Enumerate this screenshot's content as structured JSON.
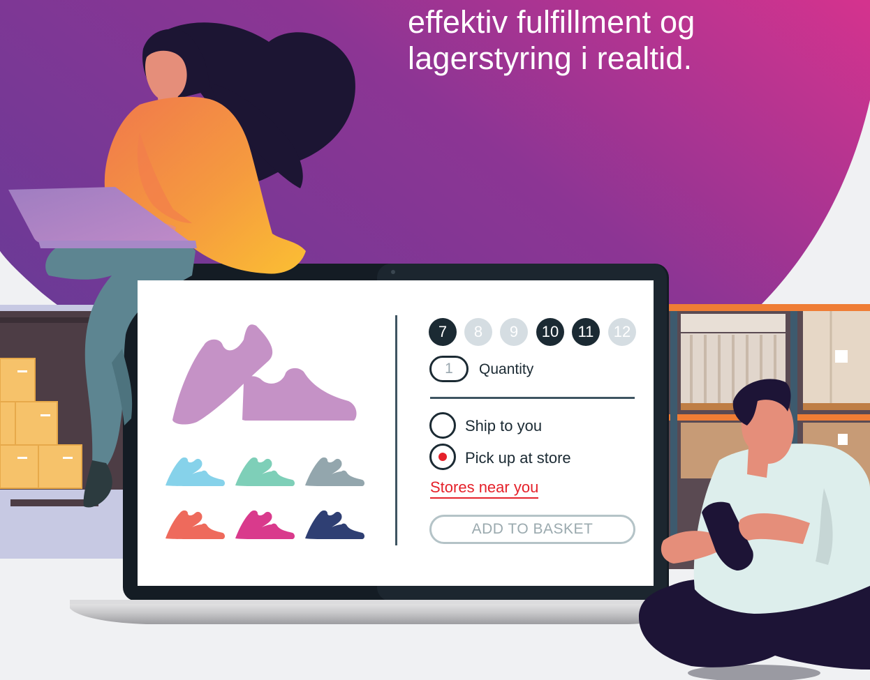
{
  "headline": {
    "line1": "effektiv fulfillment og",
    "line2": "lagerstyring i realtid."
  },
  "product": {
    "sizes": [
      {
        "label": "7",
        "available": true
      },
      {
        "label": "8",
        "available": false
      },
      {
        "label": "9",
        "available": false
      },
      {
        "label": "10",
        "available": true
      },
      {
        "label": "11",
        "available": true
      },
      {
        "label": "12",
        "available": false
      }
    ],
    "quantity_value": "1",
    "quantity_label": "Quantity",
    "ship_label": "Ship to you",
    "pickup_label": "Pick up at store",
    "selected_delivery": "pickup",
    "stores_link": "Stores near you",
    "add_button": "ADD TO BASKET"
  },
  "colors": {
    "gradient_start": "#6a3a96",
    "gradient_end": "#d4338e",
    "accent_red": "#e5212a",
    "dark": "#1b2a33",
    "shoe_main": "#c592c6",
    "swatches": [
      "#86d2ea",
      "#7ecfb8",
      "#93a6ad",
      "#ee6a5c",
      "#d93a8c",
      "#2f3f73"
    ]
  },
  "icons": {
    "hero": "sneaker-icon",
    "swatch": "sneaker-icon"
  }
}
